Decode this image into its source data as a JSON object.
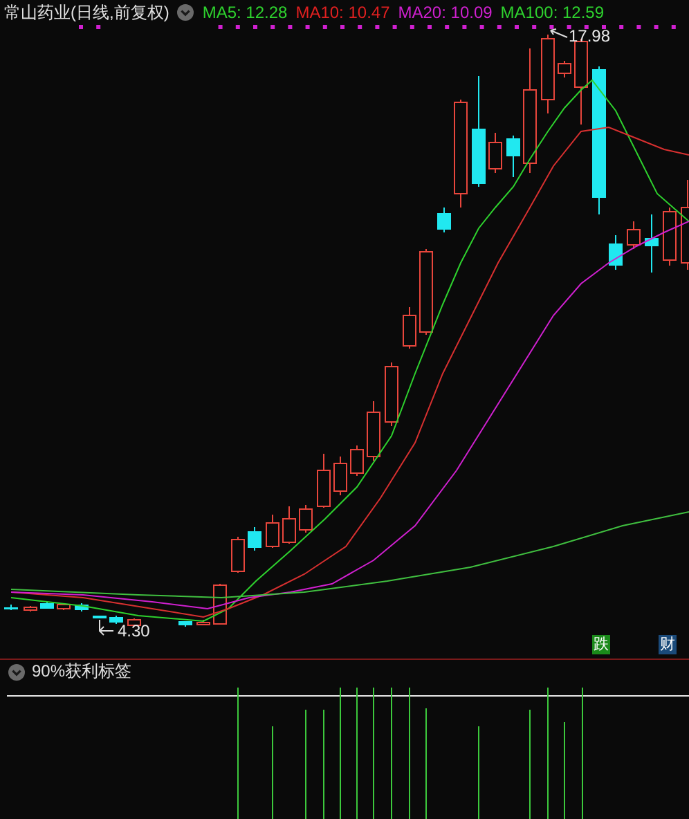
{
  "chart": {
    "title": "常山药业(日线,前复权)",
    "legend": [
      {
        "label": "MA5: 12.28",
        "color": "#2ed22e"
      },
      {
        "label": "MA10: 10.47",
        "color": "#e02020"
      },
      {
        "label": "MA20: 10.09",
        "color": "#d020d0"
      },
      {
        "label": "MA100: 12.59",
        "color": "#2ed22e"
      }
    ],
    "price_labels": [
      {
        "kind": "high",
        "text": "17.98"
      },
      {
        "kind": "low",
        "text": "4.30"
      }
    ],
    "signals": [
      {
        "text": "跌",
        "color": "#1a8a1a"
      },
      {
        "text": "财",
        "color": "#1a4a7a"
      }
    ]
  },
  "indicator": {
    "title": "90%获利标签"
  }
}
